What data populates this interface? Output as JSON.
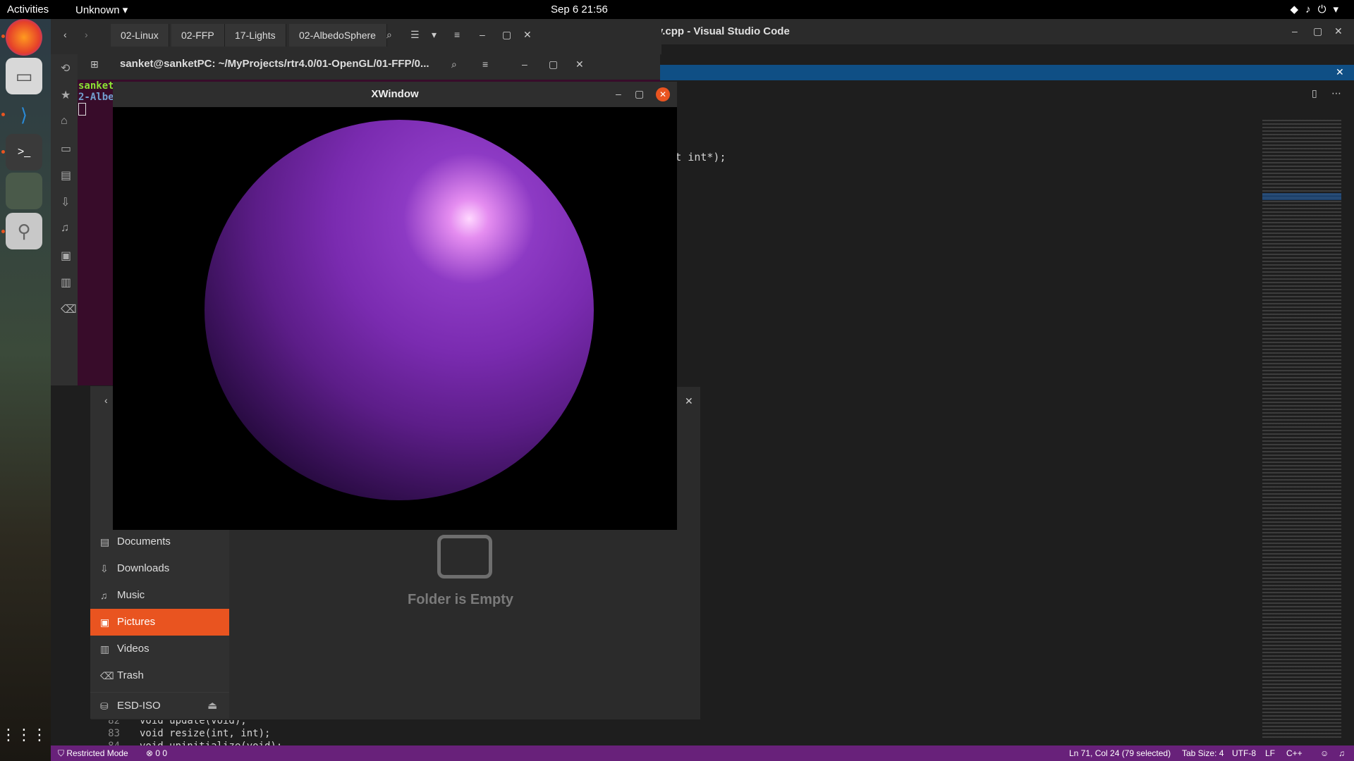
{
  "topbar": {
    "activities": "Activities",
    "app_menu": "Unknown",
    "clock": "Sep 6  21:56"
  },
  "dock": {
    "items": [
      "firefox-icon",
      "files-icon",
      "vscode-icon",
      "terminal-icon",
      "image-viewer-icon",
      "usb-drive-icon",
      "show-apps-icon"
    ]
  },
  "vscode": {
    "title": "v.cpp - Visual Studio Code",
    "editor_line": "ol, const int*);",
    "bottom_lines": [
      {
        "num": "82",
        "text": "void update(void);"
      },
      {
        "num": "83",
        "text": "void resize(int, int);"
      },
      {
        "num": "84",
        "text": "void uninitialize(void);"
      }
    ],
    "status": {
      "mode": "Restricted Mode",
      "problems": "0  0",
      "cursor": "Ln 71, Col 24 (79 selected)",
      "tab_size": "Tab Size: 4",
      "encoding": "UTF-8",
      "eol": "LF",
      "language": "C++"
    }
  },
  "files_back": {
    "path_tabs": [
      "02-Linux",
      "02-FFP",
      "17-Lights",
      "02-AlbedoSphere"
    ]
  },
  "terminal": {
    "title": "sanket@sanketPC: ~/MyProjects/rtr4.0/01-OpenGL/01-FFP/0...",
    "line1": "sanket",
    "line2": "2-Albe"
  },
  "files_front": {
    "places": [
      {
        "label": "Documents",
        "icon": "document-icon"
      },
      {
        "label": "Downloads",
        "icon": "download-icon"
      },
      {
        "label": "Music",
        "icon": "music-icon"
      },
      {
        "label": "Pictures",
        "icon": "pictures-icon"
      },
      {
        "label": "Videos",
        "icon": "videos-icon"
      },
      {
        "label": "Trash",
        "icon": "trash-icon"
      }
    ],
    "device": "ESD-ISO",
    "empty_text": "Folder is Empty",
    "active_place": "Pictures"
  },
  "xwindow": {
    "title": "XWindow",
    "sphere_color": "#7a2bb0"
  }
}
